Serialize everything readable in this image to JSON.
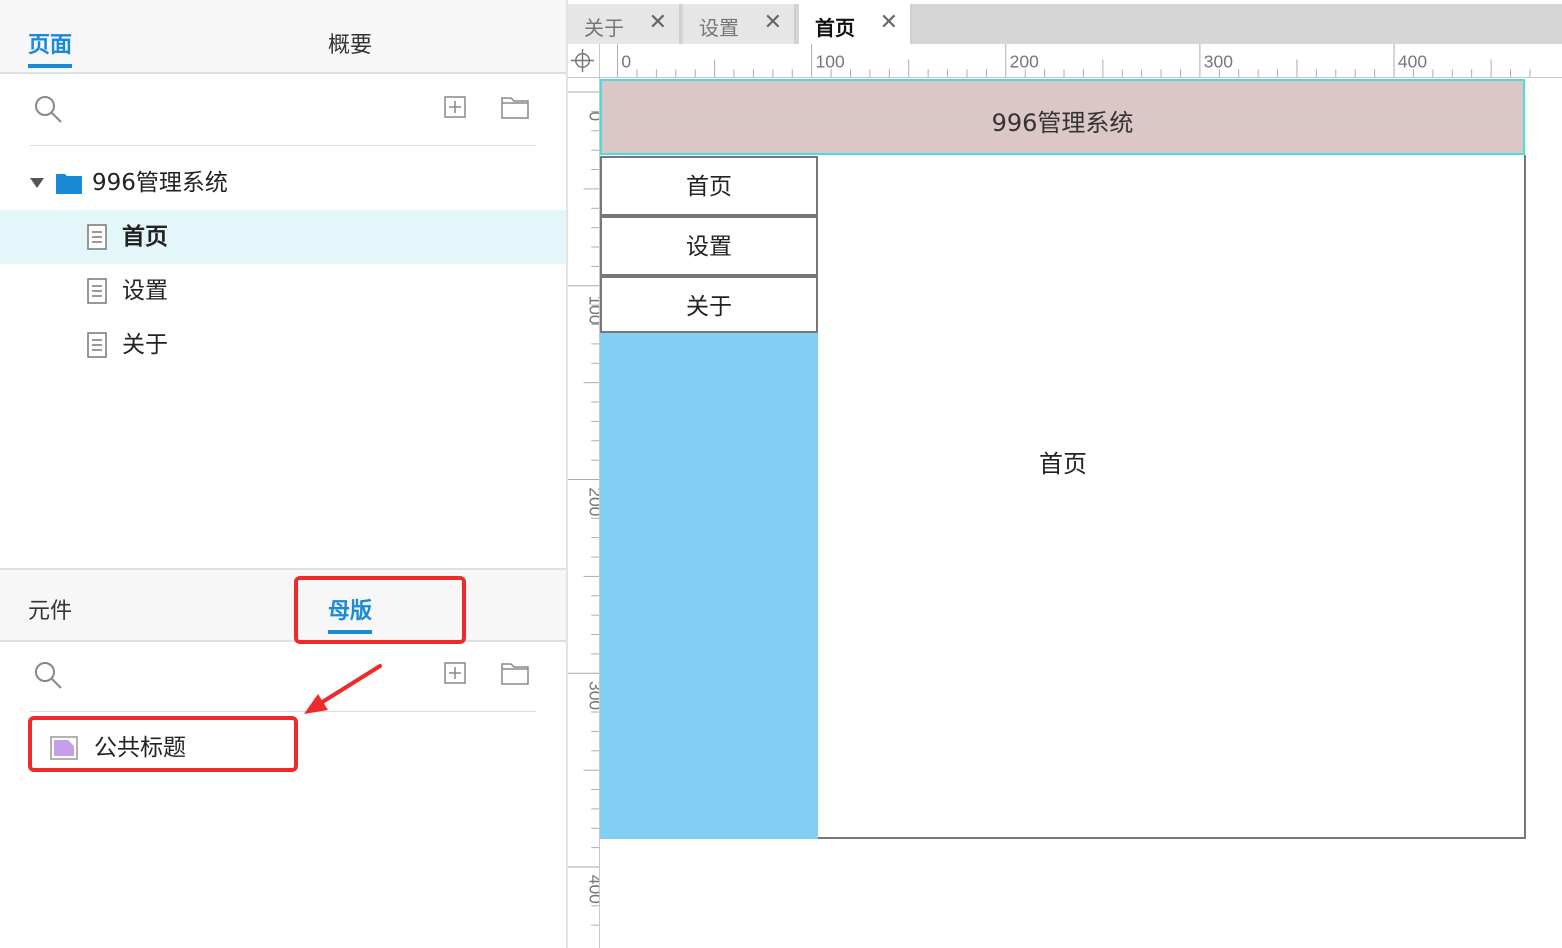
{
  "pages_panel": {
    "tabs": [
      {
        "label": "页面",
        "active": true
      },
      {
        "label": "概要",
        "active": false
      }
    ],
    "tree": {
      "root": {
        "label": "996管理系统",
        "icon": "folder-icon",
        "expanded": true
      },
      "pages": [
        {
          "label": "首页",
          "selected": true,
          "icon": "page-icon"
        },
        {
          "label": "设置",
          "selected": false,
          "icon": "page-icon"
        },
        {
          "label": "关于",
          "selected": false,
          "icon": "page-icon"
        }
      ]
    }
  },
  "library_panel": {
    "tabs": [
      {
        "label": "元件",
        "active": false
      },
      {
        "label": "母版",
        "active": true
      }
    ],
    "masters": [
      {
        "label": "公共标题",
        "icon": "master-icon"
      }
    ]
  },
  "doc_tabs": [
    {
      "label": "关于",
      "active": false
    },
    {
      "label": "设置",
      "active": false
    },
    {
      "label": "首页",
      "active": true
    }
  ],
  "rulers": {
    "horizontal": [
      "0",
      "100",
      "200",
      "300",
      "400"
    ],
    "vertical": [
      "0",
      "100",
      "200",
      "300",
      "400"
    ]
  },
  "canvas": {
    "header_text": "996管理系统",
    "nav_buttons": [
      "首页",
      "设置",
      "关于"
    ],
    "content_text": "首页"
  },
  "colors": {
    "accent": "#1a8ad6",
    "highlight": "#f0292a",
    "header_fill": "#dbc7c6",
    "header_border": "#4fd9e0",
    "sidebar_fill": "#81d0f4",
    "selected_row": "#e3f6f9"
  }
}
